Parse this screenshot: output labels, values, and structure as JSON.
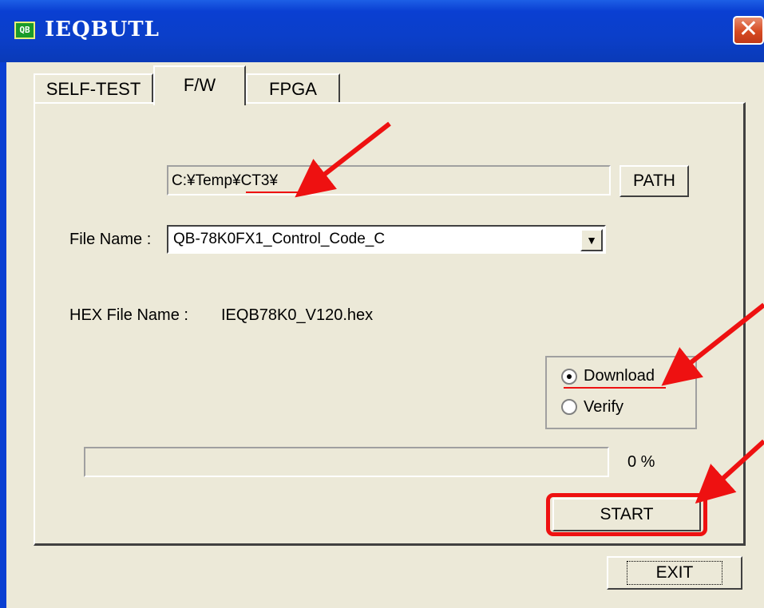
{
  "window": {
    "title": "IEQBUTL",
    "icon_text": "QB",
    "close_label": "✕"
  },
  "tabs": [
    {
      "label": "SELF-TEST",
      "active": false
    },
    {
      "label": "F/W",
      "active": true
    },
    {
      "label": "FPGA",
      "active": false
    }
  ],
  "fw": {
    "path_value": "C:¥Temp¥CT3¥",
    "path_button": "PATH",
    "file_name_label": "File Name :",
    "file_name_value": "QB-78K0FX1_Control_Code_C",
    "hex_label": "HEX File Name :",
    "hex_value": "IEQB78K0_V120.hex",
    "mode_options": [
      {
        "label": "Download",
        "selected": true
      },
      {
        "label": "Verify",
        "selected": false
      }
    ],
    "progress_percent": 0,
    "progress_text": "0 %",
    "start_button": "START"
  },
  "exit_button": "EXIT",
  "annotation_color": "#ee1111"
}
